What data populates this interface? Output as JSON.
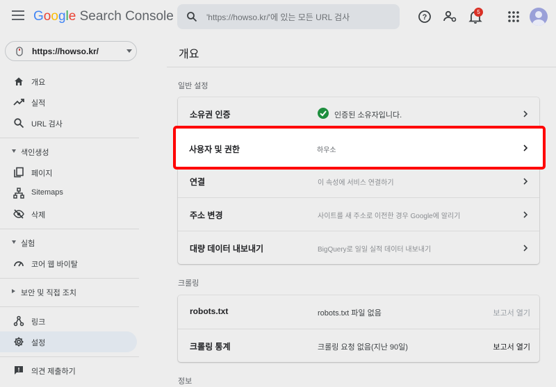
{
  "app": {
    "logo_letters": [
      "G",
      "o",
      "o",
      "g",
      "l",
      "e"
    ],
    "logo_product": "Search Console"
  },
  "search": {
    "placeholder": "'https://howso.kr/'에 있는 모든 URL 검사"
  },
  "header": {
    "notification_count": "5",
    "icons": [
      "help-icon",
      "manage-users-icon",
      "notifications-icon",
      "apps-grid-icon",
      "account-avatar-icon"
    ]
  },
  "property": {
    "name": "https://howso.kr/"
  },
  "sidebar": {
    "items": [
      {
        "label": "개요",
        "icon": "home-icon"
      },
      {
        "label": "실적",
        "icon": "trending-icon"
      },
      {
        "label": "URL 검사",
        "icon": "search-icon"
      }
    ],
    "sections": [
      {
        "label": "색인생성",
        "expanded": true,
        "items": [
          {
            "label": "페이지",
            "icon": "pages-icon"
          },
          {
            "label": "Sitemaps",
            "icon": "sitemap-icon"
          },
          {
            "label": "삭제",
            "icon": "removals-icon"
          }
        ]
      },
      {
        "label": "실험",
        "expanded": true,
        "items": [
          {
            "label": "코어 웹 바이탈",
            "icon": "gauge-icon"
          }
        ]
      },
      {
        "label": "보안 및 직접 조치",
        "expanded": false,
        "items": []
      }
    ],
    "bottom_items": [
      {
        "label": "링크",
        "icon": "links-icon"
      },
      {
        "label": "설정",
        "icon": "gear-icon",
        "active": true
      },
      {
        "label": "의견 제출하기",
        "icon": "feedback-icon"
      }
    ]
  },
  "main": {
    "title": "개요",
    "general": {
      "heading": "일반 설정",
      "rows": [
        {
          "label": "소유권 인증",
          "value": "인증된 소유자입니다."
        },
        {
          "label": "사용자 및 권한",
          "value": "하우소"
        },
        {
          "label": "연결",
          "value": "이 속성에 서비스 연결하기"
        },
        {
          "label": "주소 변경",
          "value": "사이트를 새 주소로 이전한 경우 Google에 알리기"
        },
        {
          "label": "대량 데이터 내보내기",
          "value": "BigQuery로 일일 실적 데이터 내보내기"
        }
      ]
    },
    "crawling": {
      "heading": "크롤링",
      "rows": [
        {
          "label": "robots.txt",
          "value": "robots.txt 파일 없음",
          "action": "보고서 열기"
        },
        {
          "label": "크롤링 통계",
          "value": "크롤링 요청 없음(지난 90일)",
          "action": "보고서 열기"
        }
      ]
    },
    "info": {
      "heading": "정보"
    }
  },
  "colors": {
    "highlight_border": "#ff0000",
    "verified_green": "#1e8e3e",
    "active_nav_bg": "#dfe5ec",
    "badge_red": "#d93025"
  }
}
